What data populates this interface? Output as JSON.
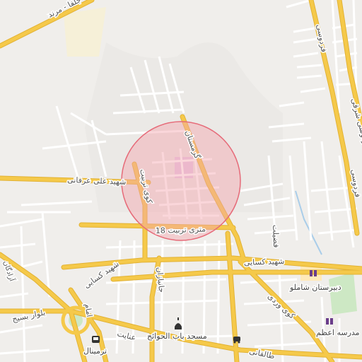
{
  "map": {
    "colors": {
      "background": "#f0eeeb",
      "terrain": "#e7e5e2",
      "minor_road": "#ffffff",
      "major_road": "#f5c94a",
      "major_road_casing": "#e2b234",
      "park": "#cde8c4",
      "poi_area": "#ffe9b8",
      "highlight_fill": "#f4a4ad",
      "highlight_stroke": "#e66b79",
      "water": "#a9cde9"
    },
    "streets": {
      "jolfa": "جلفا - مرند",
      "ferdowsi_top": "فردوسی",
      "ferdowsi_east": "فردوسی شرقی",
      "ferdowsi_west": "فردوسی",
      "shahid_ali_erfani": "شهید علی عرفانی",
      "kuy_tarbiat": "کوی تربیت",
      "garmestan": "گرمستان",
      "tarbiat_18m": "18 متری تربیت",
      "shahid_kasaei_main": "شهید کسایی",
      "shahid_kasaei_west": "شهید کسایی",
      "fazilat": "فضیلت",
      "janbazan": "جانبازان",
      "imam": "امام",
      "azadegan": "آزادگان",
      "blvd_basij": "بلوار بسیج",
      "vardi": "کوی وردی",
      "enayat": "عنایت",
      "taleghani": "طالقانی"
    },
    "pois": {
      "shamlu_school": "دبیرستان شاملو",
      "azam_school": "مدرسه اعظم",
      "bab_al_havaej_mosque": "مسجد باب الحوائج",
      "terminal": "ترمینال"
    },
    "icons": {
      "school": "school-icon",
      "mosque": "mosque-icon",
      "terminal": "bus-icon",
      "car": "car-icon"
    }
  }
}
